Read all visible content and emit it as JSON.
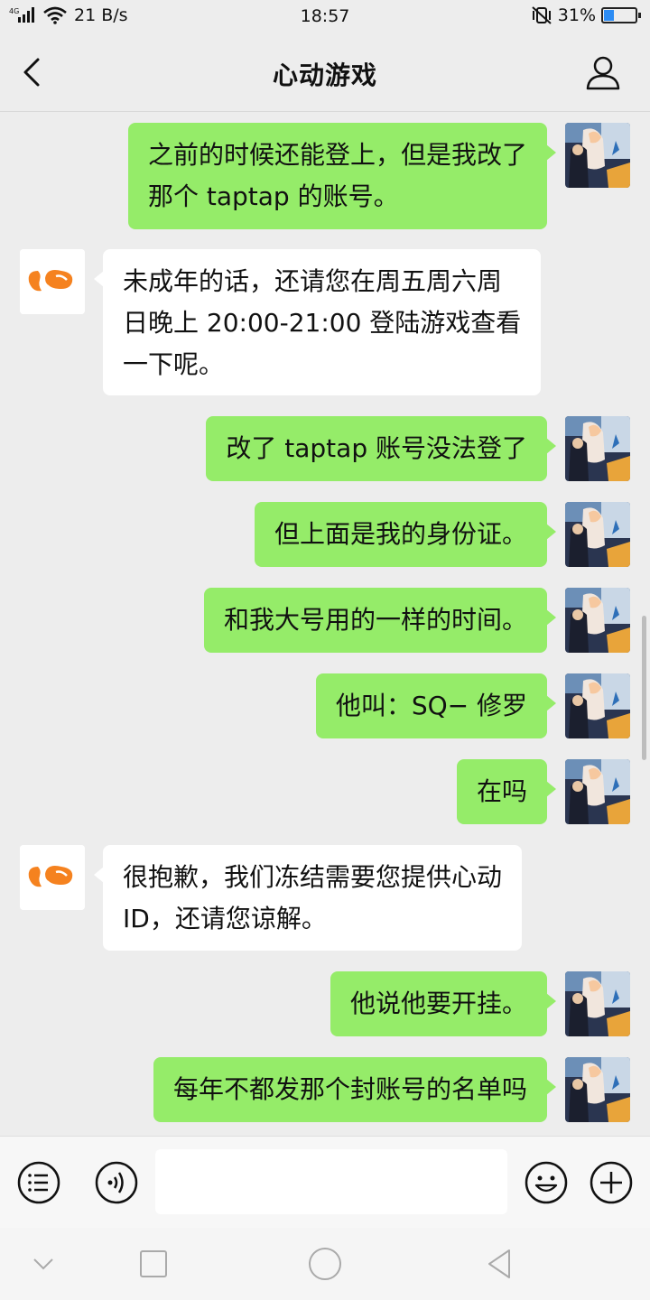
{
  "status_bar": {
    "network": "4G",
    "speed": "21 B/s",
    "time": "18:57",
    "battery": "31%",
    "battery_level": 0.31
  },
  "header": {
    "title": "心动游戏"
  },
  "messages": [
    {
      "from": "user",
      "text": "之前的时候还能登上，但是我改了\n那个 taptap 的账号。"
    },
    {
      "from": "bot",
      "text": "未成年的话，还请您在周五周六周\n日晚上 20:00-21:00 登陆游戏查看\n一下呢。"
    },
    {
      "from": "user",
      "text": "改了 taptap 账号没法登了"
    },
    {
      "from": "user",
      "text": "但上面是我的身份证。"
    },
    {
      "from": "user",
      "text": "和我大号用的一样的时间。"
    },
    {
      "from": "user",
      "text": "他叫：SQ− 修罗"
    },
    {
      "from": "user",
      "text": "在吗"
    },
    {
      "from": "bot",
      "text": "很抱歉，我们冻结需要您提供心动\nID，还请您谅解。"
    },
    {
      "from": "user",
      "text": "他说他要开挂。"
    },
    {
      "from": "user",
      "text": "每年不都发那个封账号的名单吗"
    }
  ],
  "input": {
    "value": ""
  },
  "colors": {
    "user_bubble": "#95ec69",
    "bot_bubble": "#ffffff",
    "brand_orange": "#f5821f"
  },
  "icons": [
    "back-arrow-icon",
    "profile-icon",
    "menu-list-icon",
    "voice-icon",
    "emoji-icon",
    "plus-icon",
    "nav-down-icon",
    "nav-square-icon",
    "nav-home-icon",
    "nav-back-icon"
  ]
}
